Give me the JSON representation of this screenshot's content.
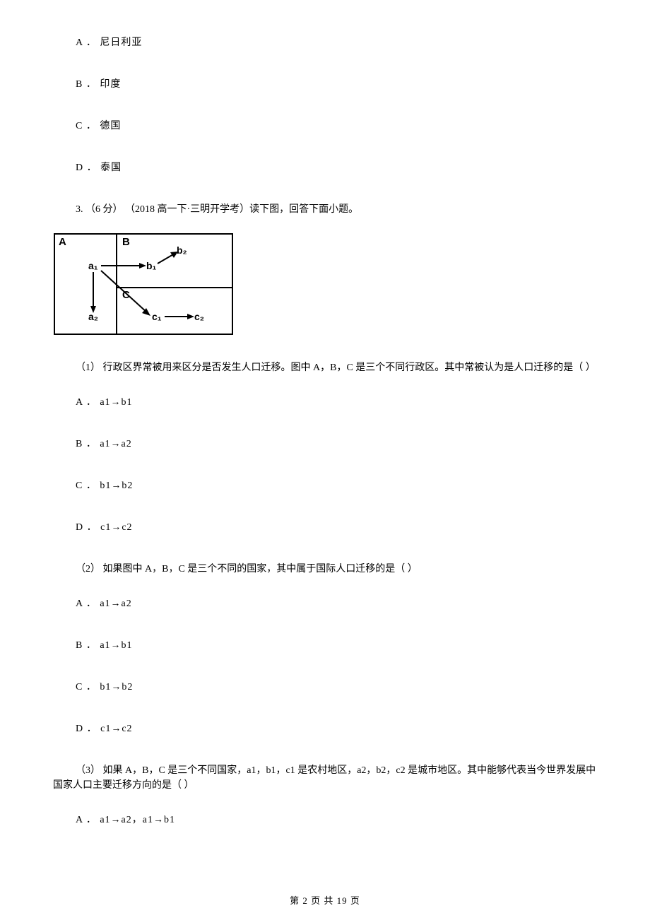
{
  "top_options": {
    "A": "A ． 尼日利亚",
    "B": "B ． 印度",
    "C": "C ． 德国",
    "D": "D ． 泰国"
  },
  "q3": {
    "line": "3.  （6 分）  （2018 高一下·三明开学考）读下图，回答下面小题。",
    "diagram_labels": {
      "A": "A",
      "B": "B",
      "C": "C",
      "a1": "a₁",
      "a2": "a₂",
      "b1": "b₁",
      "b2": "b₂",
      "c1": "c₁",
      "c2": "c₂"
    },
    "sub1": {
      "text": "（1）  行政区界常被用来区分是否发生人口迁移。图中 A，B，C 是三个不同行政区。其中常被认为是人口迁移的是（     ）",
      "A": "A ． a1→b1",
      "B": "B ． a1→a2",
      "C": "C ． b1→b2",
      "D": "D ． c1→c2"
    },
    "sub2": {
      "text": "（2）  如果图中 A，B，C 是三个不同的国家，其中属于国际人口迁移的是（     ）",
      "A": "A ． a1→a2",
      "B": "B ． a1→b1",
      "C": "C ． b1→b2",
      "D": "D ． c1→c2"
    },
    "sub3": {
      "text": "（3）  如果 A，B，C 是三个不同国家，a1，b1，c1 是农村地区，a2，b2，c2 是城市地区。其中能够代表当今世界发展中国家人口主要迁移方向的是（     ）",
      "A": "A ． a1→a2，a1→b1"
    }
  },
  "footer": "第 2 页 共 19 页"
}
